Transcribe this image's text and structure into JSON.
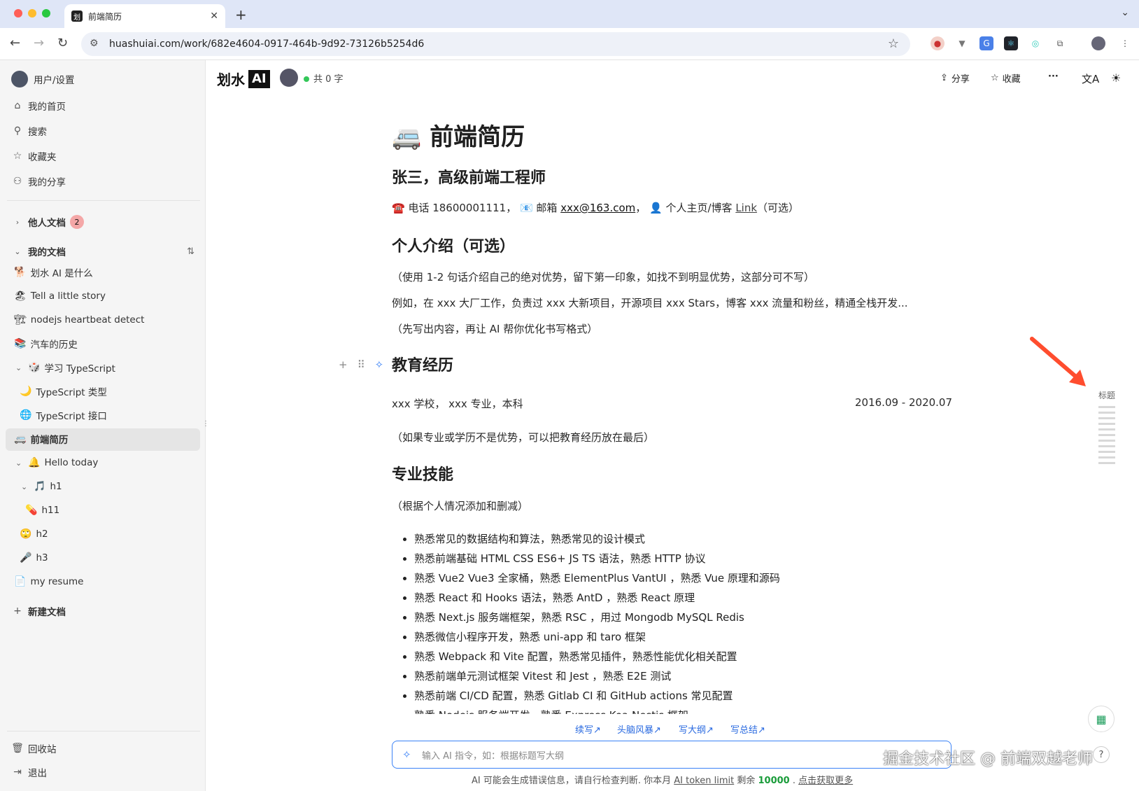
{
  "browser": {
    "tab_title": "前端简历",
    "tab_favicon": "划",
    "url": "huashuiai.com/work/682e4604-0917-464b-9d92-73126b5254d6"
  },
  "sidebar": {
    "user_settings": "用户/设置",
    "nav": [
      {
        "label": "我的首页",
        "icon": "home-icon"
      },
      {
        "label": "搜索",
        "icon": "search-icon"
      },
      {
        "label": "收藏夹",
        "icon": "star-icon"
      },
      {
        "label": "我的分享",
        "icon": "users-icon"
      }
    ],
    "others_docs": "他人文档",
    "others_docs_count": "2",
    "my_docs": "我的文档",
    "docs": [
      {
        "emoji": "🐕",
        "label": "划水 AI 是什么"
      },
      {
        "emoji": "🏖",
        "label": "Tell a little story"
      },
      {
        "emoji": "🏗",
        "label": "nodejs heartbeat detect"
      },
      {
        "emoji": "📚",
        "label": "汽车的历史"
      },
      {
        "emoji": "🎲",
        "label": "学习 TypeScript"
      },
      {
        "emoji": "🌙",
        "label": "TypeScript 类型"
      },
      {
        "emoji": "🌐",
        "label": "TypeScript 接口"
      },
      {
        "emoji": "🚐",
        "label": "前端简历"
      },
      {
        "emoji": "🔔",
        "label": "Hello today"
      },
      {
        "emoji": "🎵",
        "label": "h1"
      },
      {
        "emoji": "💊",
        "label": "h11"
      },
      {
        "emoji": "🙄",
        "label": "h2"
      },
      {
        "emoji": "🎤",
        "label": "h3"
      },
      {
        "emoji": "📄",
        "label": "my resume"
      }
    ],
    "new_doc": "新建文档",
    "trash": "回收站",
    "logout": "退出"
  },
  "topbar": {
    "logo_text": "划水",
    "logo_ai": "AI",
    "word_count": "共 0 字",
    "share": "分享",
    "favorite": "收藏",
    "more": "···"
  },
  "doc": {
    "title_emoji": "🚐",
    "title": "前端简历",
    "name_heading": "张三，高级前端工程师",
    "contact_prefix": "☎️ 电话 18600001111， 📧 邮箱 ",
    "contact_email": "xxx@163.com",
    "contact_mid": "， 👤 个人主页/博客 ",
    "contact_link": "Link",
    "contact_suffix": "（可选）",
    "intro_heading": "个人介绍（可选）",
    "intro_p1": "（使用 1-2 句话介绍自己的绝对优势，留下第一印象，如找不到明显优势，这部分可不写）",
    "intro_p2": "例如，在 xxx 大厂工作，负责过 xxx 大新项目，开源项目 xxx Stars，博客 xxx 流量和粉丝，精通全栈开发...",
    "intro_p3": "（先写出内容，再让 AI 帮你优化书写格式）",
    "edu_heading": "教育经历",
    "edu_line": "xxx 学校， xxx 专业，本科",
    "edu_date": "2016.09 - 2020.07",
    "edu_note": "（如果专业或学历不是优势，可以把教育经历放在最后）",
    "skills_heading": "专业技能",
    "skills_note": "（根据个人情况添加和删减）",
    "skills": [
      "熟悉常见的数据结构和算法，熟悉常见的设计模式",
      "熟悉前端基础 HTML CSS ES6+ JS TS 语法，熟悉 HTTP 协议",
      "熟悉 Vue2 Vue3 全家桶，熟悉 ElementPlus VantUI ，熟悉 Vue 原理和源码",
      "熟悉 React 和 Hooks 语法，熟悉 AntD ，熟悉 React 原理",
      "熟悉 Next.js 服务端框架，熟悉 RSC ，用过 Mongodb MySQL Redis",
      "熟悉微信小程序开发，熟悉 uni-app 和 taro 框架",
      "熟悉 Webpack 和 Vite 配置，熟悉常见插件，熟悉性能优化相关配置",
      "熟悉前端单元测试框架 Vitest 和 Jest ，熟悉 E2E 测试",
      "熟悉前端 CI/CD 配置，熟悉 Gitlab CI 和 GitHub actions 常见配置",
      "熟悉 Nodejs 服务端开发，熟悉 Express Koa Nestjs 框架"
    ]
  },
  "toc": {
    "label": "标题"
  },
  "ai": {
    "actions": [
      "续写↗",
      "头脑风暴↗",
      "写大纲↗",
      "写总结↗"
    ],
    "placeholder": "输入 AI 指令，如：根据标题写大纲",
    "footnote_pre": "AI 可能会生成错误信息，请自行检查判断. 你本月 ",
    "footnote_link": "AI token limit",
    "footnote_mid": " 剩余 ",
    "footnote_count": "10000",
    "footnote_sep": " . ",
    "footnote_more": "点击获取更多"
  },
  "watermark": "掘金技术社区 @ 前端双越老师",
  "colors": {
    "accent": "#3b82f6",
    "active_row": "#e5e5e5",
    "arrow": "#ff4d2e"
  }
}
